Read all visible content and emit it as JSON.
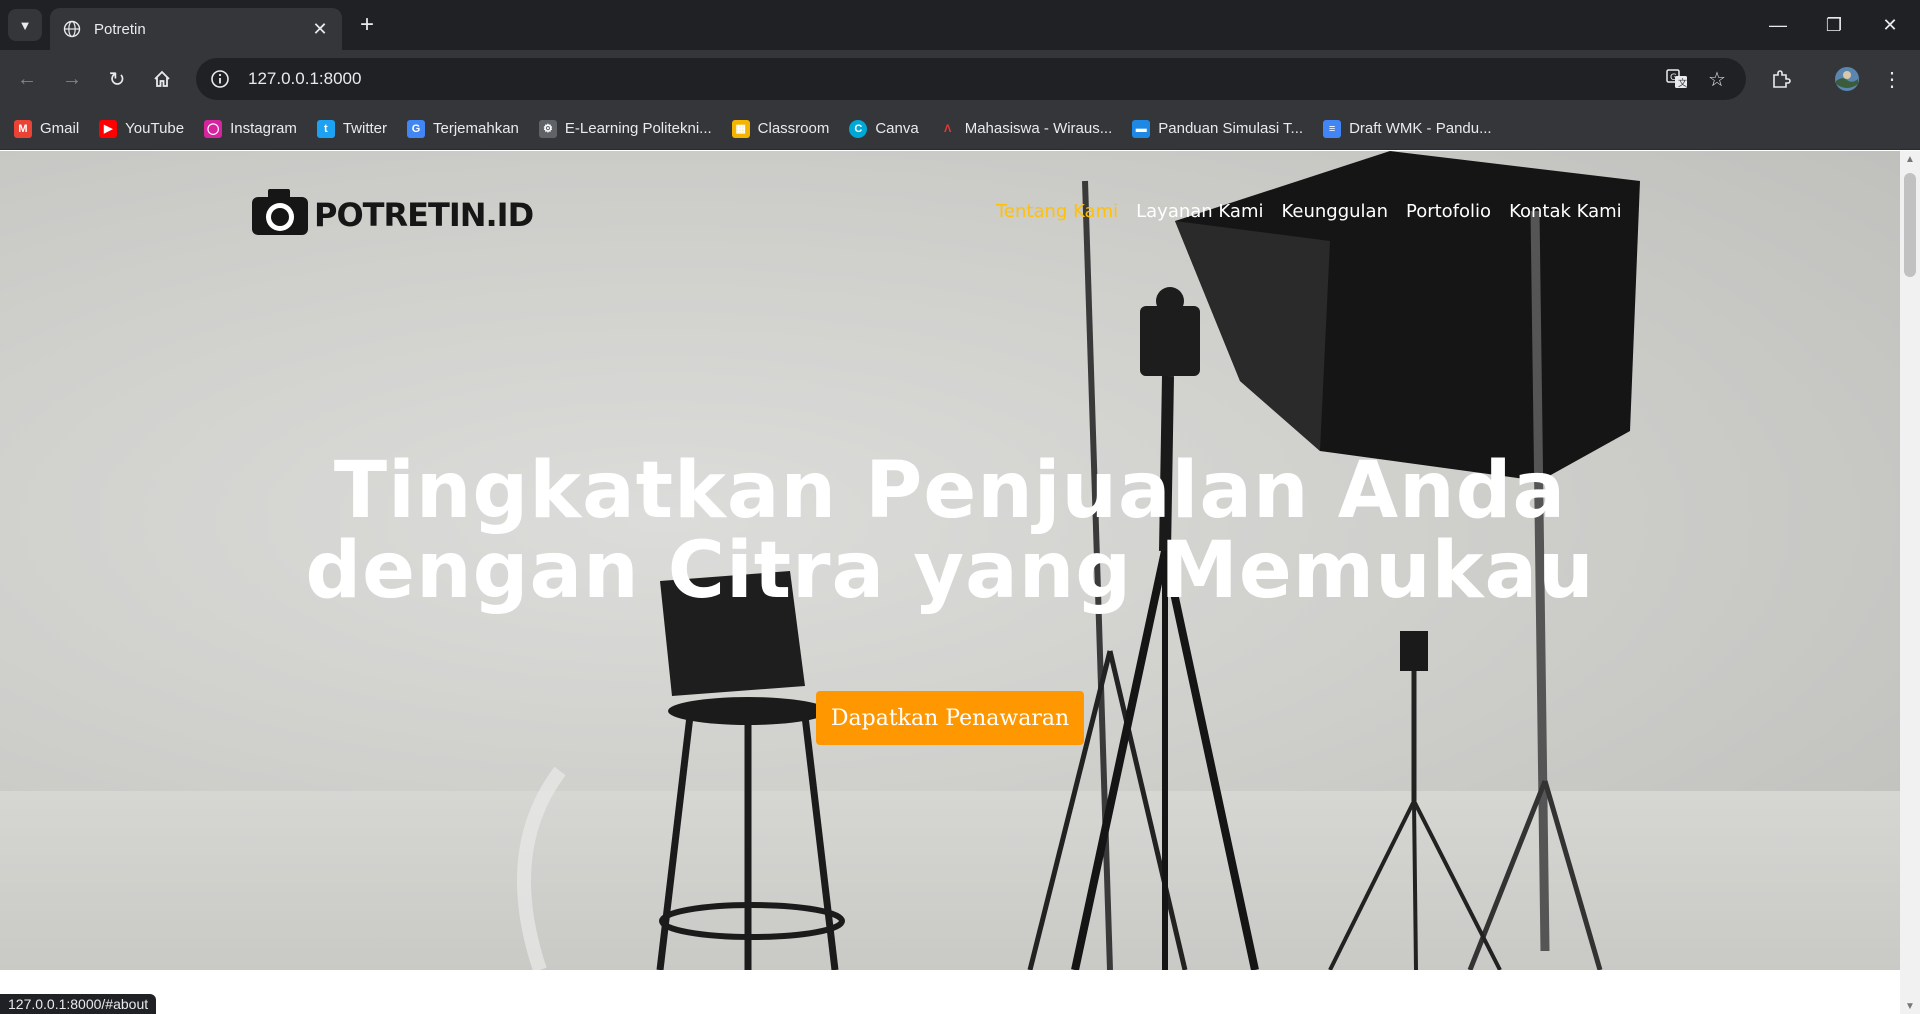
{
  "browser": {
    "tab": {
      "title": "Potretin"
    },
    "address": {
      "url": "127.0.0.1:8000"
    },
    "bookmarks": [
      {
        "label": "Gmail",
        "icon": "gmail-icon",
        "color": "#ea4335"
      },
      {
        "label": "YouTube",
        "icon": "youtube-icon",
        "color": "#ff0000"
      },
      {
        "label": "Instagram",
        "icon": "instagram-icon",
        "color": "#d6249f"
      },
      {
        "label": "Twitter",
        "icon": "twitter-icon",
        "color": "#1da1f2"
      },
      {
        "label": "Terjemahkan",
        "icon": "translate-icon",
        "color": "#4285f4"
      },
      {
        "label": "E-Learning Politekni...",
        "icon": "elearning-icon",
        "color": "#9aa0a6"
      },
      {
        "label": "Classroom",
        "icon": "classroom-icon",
        "color": "#f4b400"
      },
      {
        "label": "Canva",
        "icon": "canva-icon",
        "color": "#00c4cc"
      },
      {
        "label": "Mahasiswa - Wiraus...",
        "icon": "mahasiswa-icon",
        "color": "#e53935"
      },
      {
        "label": "Panduan Simulasi T...",
        "icon": "panduan-icon",
        "color": "#1e88e5"
      },
      {
        "label": "Draft WMK - Pandu...",
        "icon": "docs-icon",
        "color": "#4285f4"
      }
    ],
    "status_url": "127.0.0.1:8000/#about"
  },
  "site": {
    "logo_text": "POTRETIN.ID",
    "nav": [
      {
        "label": "Tentang Kami",
        "active": true
      },
      {
        "label": "Layanan Kami",
        "active": false
      },
      {
        "label": "Keunggulan",
        "active": false
      },
      {
        "label": "Portofolio",
        "active": false
      },
      {
        "label": "Kontak Kami",
        "active": false
      }
    ],
    "hero": {
      "headline_line1": "Tingkatkan Penjualan Anda",
      "headline_line2": "dengan Citra yang Memukau",
      "cta_label": "Dapatkan Penawaran"
    }
  },
  "colors": {
    "accent": "#ff9800",
    "nav_active": "#ffc107",
    "chrome_dark": "#202124",
    "chrome": "#35363a"
  }
}
